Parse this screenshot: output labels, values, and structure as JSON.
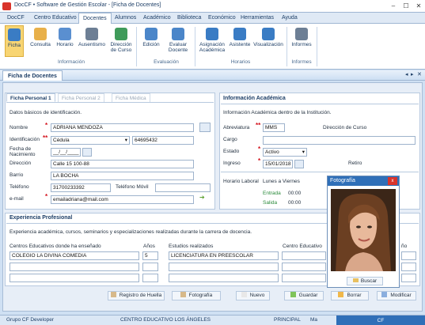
{
  "window": {
    "title": "DocCF • Software de Gestión Escolar - [Ficha de Docentes]"
  },
  "menu": [
    "DocCF",
    "Centro Educativo",
    "Docentes",
    "Alumnos",
    "Académico",
    "Biblioteca",
    "Económico",
    "Herramientas",
    "Ayuda"
  ],
  "ribbon": {
    "buttons": [
      "Ficha",
      "Consulta",
      "Horario",
      "Ausentismo",
      "Dirección de Curso",
      "Edición",
      "Evaluar Docente",
      "Asignación Académica",
      "Asistente",
      "Visualización",
      "Informes"
    ],
    "groups": [
      "Información",
      "Evaluación",
      "Horarios",
      "Informes"
    ]
  },
  "panel": {
    "title": "Ficha de Docentes"
  },
  "personal": {
    "tabs": [
      "Ficha Personal 1",
      "Ficha Personal 2",
      "Ficha Médica"
    ],
    "subtitle": "Datos básicos de identificación.",
    "labels": {
      "nombre": "Nombre",
      "identificacion": "Identificación",
      "fecha": "Fecha de Nacimiento",
      "direccion": "Dirección",
      "barrio": "Barrio",
      "telefono": "Teléfono",
      "movil": "Teléfono Móvil",
      "email": "e-mail"
    },
    "values": {
      "nombre": "ADRIANA MENDOZA",
      "tipo_id": "Cédula",
      "numero_id": "64695432",
      "fecha": "__/__/____",
      "direccion": "Calle 15 100-88",
      "barrio": "LA BOCHA",
      "telefono": "31700233392",
      "movil": "",
      "email": "emailadriana@mail.com"
    }
  },
  "academica": {
    "title": "Información Académica",
    "subtitle": "Información Académica dentro de la Institución.",
    "labels": {
      "abreviatura": "Abreviatura",
      "direccion_curso": "Dirección de Curso",
      "cargo": "Cargo",
      "estado": "Estado",
      "ingreso": "Ingreso",
      "retiro": "Retiro",
      "horario": "Horario Laboral"
    },
    "values": {
      "abreviatura": "MMS",
      "cargo": "",
      "estado": "Activo",
      "ingreso": "15/01/2018",
      "dias": "Lunes a Viernes",
      "entrada_label": "Entrada",
      "entrada": "00:00",
      "salida_label": "Salida",
      "salida": "00:00"
    }
  },
  "experiencia": {
    "title": "Experiencia Profesional",
    "subtitle": "Experiencia académica, cursos, seminarios y especializaciones realizadas durante la carrera de docencia.",
    "columns": [
      "Centros Educativos donde ha enseñado",
      "Años",
      "Estudios realizados",
      "Centro Educativo",
      "ño"
    ],
    "row1": {
      "centro": "COLEGIO LA DIVINA COMEDIA",
      "anos": "5",
      "estudio": "LICENCIATURA EN PREESCOLAR"
    }
  },
  "photo": {
    "title": "Fotografía",
    "close": "x",
    "button": "Buscar"
  },
  "actions": [
    "Registro de Huella",
    "Fotografía",
    "Nuevo",
    "Guardar",
    "Borrar",
    "Modificar"
  ],
  "status": {
    "user": "Grupo CF Developer",
    "school": "CENTRO EDUCATIVO LOS ÁNGELES",
    "role": "PRINCIPAL",
    "extra": "Ma",
    "brand": "CF"
  },
  "colors": {
    "accent": "#2f6fb8",
    "required": "#d3101b",
    "selected": "#f8d573"
  }
}
